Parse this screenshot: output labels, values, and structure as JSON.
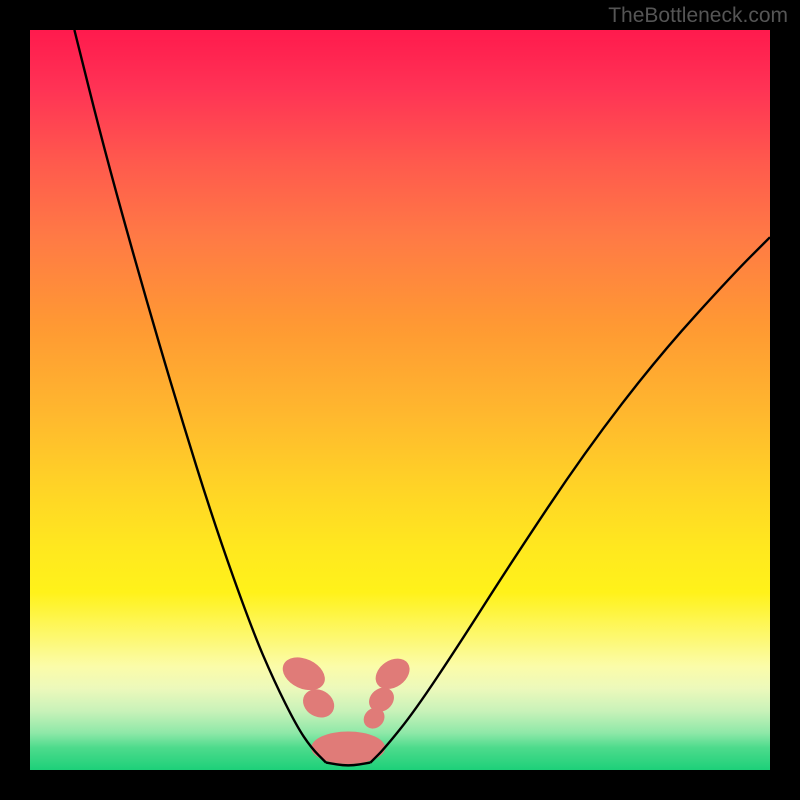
{
  "watermark": "TheBottleneck.com",
  "chart_data": {
    "type": "line",
    "title": "",
    "xlabel": "",
    "ylabel": "",
    "x_range": [
      0,
      100
    ],
    "y_range": [
      0,
      100
    ],
    "grid": false,
    "gradient_colors": {
      "top": "#ff1a4d",
      "upper_mid": "#ff9933",
      "mid": "#ffe81f",
      "lower_mid": "#fdf86f",
      "bottom": "#1dd079"
    },
    "series": [
      {
        "name": "left-descending-curve",
        "stroke": "#000000",
        "x": [
          6,
          10,
          15,
          20,
          25,
          30,
          33,
          36,
          38,
          40
        ],
        "y": [
          100,
          84,
          66,
          49,
          33,
          19,
          12,
          6,
          3,
          1
        ]
      },
      {
        "name": "right-ascending-curve",
        "stroke": "#000000",
        "x": [
          46,
          48,
          52,
          58,
          65,
          75,
          85,
          95,
          100
        ],
        "y": [
          1,
          3,
          8,
          17,
          28,
          43,
          56,
          67,
          72
        ]
      },
      {
        "name": "bottom-connector",
        "stroke": "#000000",
        "x": [
          40,
          43,
          46
        ],
        "y": [
          1,
          0.5,
          1
        ]
      }
    ],
    "markers": [
      {
        "name": "left-upper-blob",
        "color": "#e07b78",
        "x": 37,
        "y": 13,
        "rx": 2.0,
        "ry": 3.0,
        "rotation": -65
      },
      {
        "name": "left-lower-blob",
        "color": "#e07b78",
        "x": 39,
        "y": 9,
        "rx": 1.8,
        "ry": 2.2,
        "rotation": -60
      },
      {
        "name": "right-upper-blob",
        "color": "#e07b78",
        "x": 49,
        "y": 13,
        "rx": 1.8,
        "ry": 2.5,
        "rotation": 55
      },
      {
        "name": "right-mid-blob",
        "color": "#e07b78",
        "x": 47.5,
        "y": 9.5,
        "rx": 1.5,
        "ry": 1.8,
        "rotation": 50
      },
      {
        "name": "right-lower-blob",
        "color": "#e07b78",
        "x": 46.5,
        "y": 7,
        "rx": 1.3,
        "ry": 1.5,
        "rotation": 45
      },
      {
        "name": "bottom-blob",
        "color": "#e07b78",
        "x": 43,
        "y": 3,
        "rx": 5.0,
        "ry": 2.2,
        "rotation": 0
      }
    ]
  }
}
